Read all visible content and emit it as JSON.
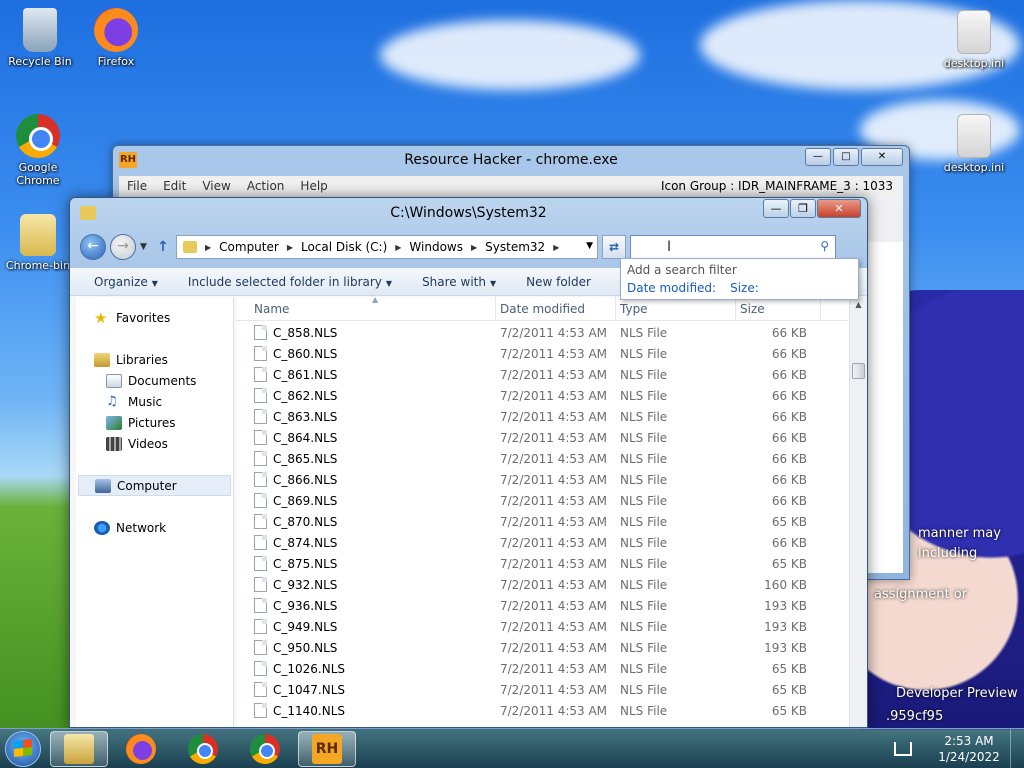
{
  "desktop": {
    "icons": [
      {
        "label": "Recycle Bin"
      },
      {
        "label": "Firefox"
      },
      {
        "label": "Google Chrome"
      },
      {
        "label": "Chrome-bin"
      },
      {
        "label": "desktop.ini"
      },
      {
        "label": "desktop.ini"
      }
    ],
    "overlay_text": [
      "manner may",
      "including",
      "assignment or",
      "Developer Preview",
      ".959cf95"
    ]
  },
  "resource_hacker": {
    "title": "Resource Hacker - chrome.exe",
    "logo": "RH",
    "menu": [
      "File",
      "Edit",
      "View",
      "Action",
      "Help"
    ],
    "status": "Icon Group : IDR_MAINFRAME_3 : 1033"
  },
  "explorer": {
    "title": "C:\\Windows\\System32",
    "address": [
      "Computer",
      "Local Disk (C:)",
      "Windows",
      "System32"
    ],
    "search": {
      "placeholder": ""
    },
    "filter_popup": {
      "label": "Add a search filter",
      "options": [
        "Date modified:",
        "Size:"
      ]
    },
    "commands": [
      "Organize",
      "Include selected folder in library",
      "Share with",
      "New folder"
    ],
    "nav": {
      "favorites": "Favorites",
      "libraries": "Libraries",
      "library_items": [
        "Documents",
        "Music",
        "Pictures",
        "Videos"
      ],
      "computer": "Computer",
      "network": "Network"
    },
    "columns": {
      "name": "Name",
      "date": "Date modified",
      "type": "Type",
      "size": "Size"
    },
    "files": [
      {
        "name": "C_858.NLS",
        "date": "7/2/2011 4:53 AM",
        "type": "NLS File",
        "size": "66 KB"
      },
      {
        "name": "C_860.NLS",
        "date": "7/2/2011 4:53 AM",
        "type": "NLS File",
        "size": "66 KB"
      },
      {
        "name": "C_861.NLS",
        "date": "7/2/2011 4:53 AM",
        "type": "NLS File",
        "size": "66 KB"
      },
      {
        "name": "C_862.NLS",
        "date": "7/2/2011 4:53 AM",
        "type": "NLS File",
        "size": "66 KB"
      },
      {
        "name": "C_863.NLS",
        "date": "7/2/2011 4:53 AM",
        "type": "NLS File",
        "size": "66 KB"
      },
      {
        "name": "C_864.NLS",
        "date": "7/2/2011 4:53 AM",
        "type": "NLS File",
        "size": "66 KB"
      },
      {
        "name": "C_865.NLS",
        "date": "7/2/2011 4:53 AM",
        "type": "NLS File",
        "size": "66 KB"
      },
      {
        "name": "C_866.NLS",
        "date": "7/2/2011 4:53 AM",
        "type": "NLS File",
        "size": "66 KB"
      },
      {
        "name": "C_869.NLS",
        "date": "7/2/2011 4:53 AM",
        "type": "NLS File",
        "size": "66 KB"
      },
      {
        "name": "C_870.NLS",
        "date": "7/2/2011 4:53 AM",
        "type": "NLS File",
        "size": "65 KB"
      },
      {
        "name": "C_874.NLS",
        "date": "7/2/2011 4:53 AM",
        "type": "NLS File",
        "size": "66 KB"
      },
      {
        "name": "C_875.NLS",
        "date": "7/2/2011 4:53 AM",
        "type": "NLS File",
        "size": "65 KB"
      },
      {
        "name": "C_932.NLS",
        "date": "7/2/2011 4:53 AM",
        "type": "NLS File",
        "size": "160 KB"
      },
      {
        "name": "C_936.NLS",
        "date": "7/2/2011 4:53 AM",
        "type": "NLS File",
        "size": "193 KB"
      },
      {
        "name": "C_949.NLS",
        "date": "7/2/2011 4:53 AM",
        "type": "NLS File",
        "size": "193 KB"
      },
      {
        "name": "C_950.NLS",
        "date": "7/2/2011 4:53 AM",
        "type": "NLS File",
        "size": "193 KB"
      },
      {
        "name": "C_1026.NLS",
        "date": "7/2/2011 4:53 AM",
        "type": "NLS File",
        "size": "65 KB"
      },
      {
        "name": "C_1047.NLS",
        "date": "7/2/2011 4:53 AM",
        "type": "NLS File",
        "size": "65 KB"
      },
      {
        "name": "C_1140.NLS",
        "date": "7/2/2011 4:53 AM",
        "type": "NLS File",
        "size": "65 KB"
      }
    ]
  },
  "taskbar": {
    "rh_label": "RH",
    "time": "2:53 AM",
    "date": "1/24/2022"
  }
}
